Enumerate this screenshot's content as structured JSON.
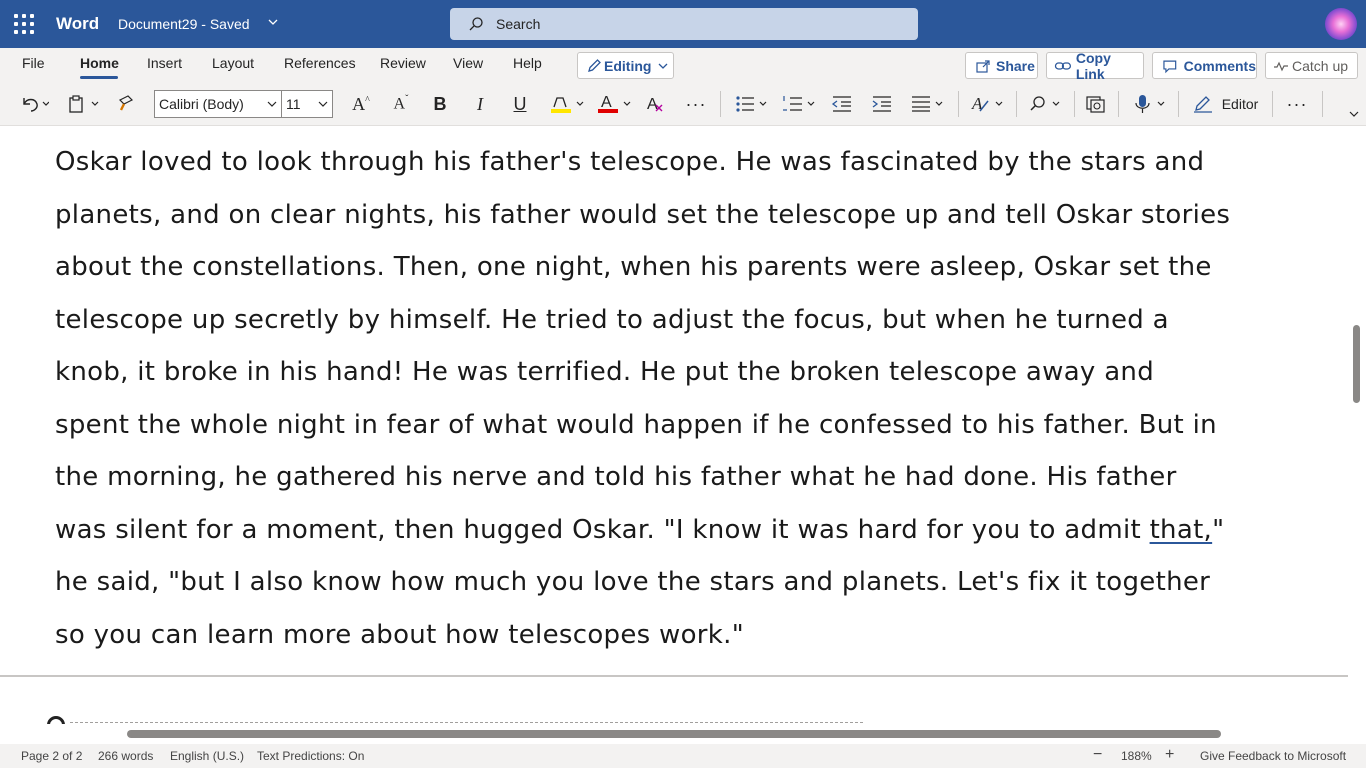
{
  "titlebar": {
    "app_name": "Word",
    "document_title": "Document29  -  Saved",
    "search_placeholder": "Search",
    "avatar_icon": "profile-avatar"
  },
  "menu": {
    "tabs": [
      "File",
      "Home",
      "Insert",
      "Layout",
      "References",
      "Review",
      "View",
      "Help"
    ],
    "active_tab": "Home",
    "editing_label": "Editing",
    "share_label": "Share",
    "copy_link_label": "Copy Link",
    "comments_label": "Comments",
    "catchup_label": "Catch up"
  },
  "ribbon": {
    "font_name": "Calibri (Body)",
    "font_size": "11",
    "editor_label": "Editor",
    "highlight_color": "#ffe600",
    "font_color": "#e00000"
  },
  "document": {
    "paragraph_before": "Oskar loved to look through his father's telescope. He was fascinated by the stars and planets, and on clear nights, his father would set the telescope up and tell Oskar stories about the constellations. Then, one night, when his parents were asleep, Oskar set the telescope up secretly by himself. He tried to adjust the focus, but when he turned a knob, it broke in his hand! He was terrified. He put the broken telescope away and spent the whole night in fear of what would happen if he confessed to his father. But in the morning, he gathered his nerve and told his father what he had done. His father was silent for a moment, then hugged Oskar. \"I know it was hard for you to admit ",
    "flagged_word": "that,",
    "paragraph_after": "\" he said, \"but I also know how much you love the stars and planets. Let's fix it together so you can learn more about how telescopes work.\""
  },
  "status": {
    "page": "Page 2 of 2",
    "words": "266 words",
    "language": "English (U.S.)",
    "predictions": "Text Predictions: On",
    "zoom": "188%",
    "feedback": "Give Feedback to Microsoft"
  },
  "colors": {
    "brand": "#2b579a",
    "ribbon_bg": "#f3f2f1"
  }
}
